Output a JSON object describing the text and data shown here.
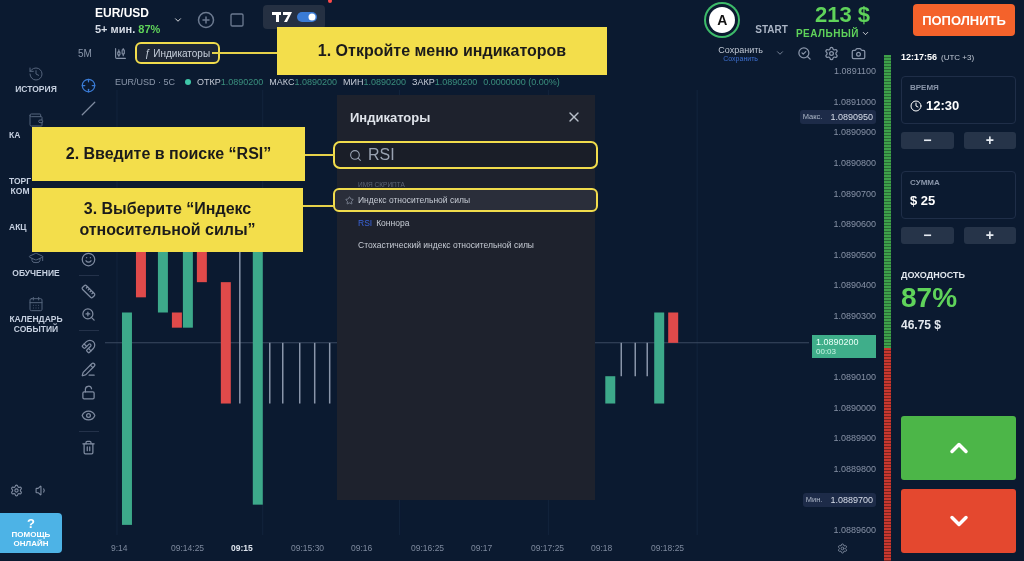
{
  "asset": {
    "pair": "EUR/USD",
    "duration": "5+ мин.",
    "payout": "87%"
  },
  "account": {
    "avatar": "A",
    "level": "START",
    "balance": "213 $",
    "type": "РЕАЛЬНЫЙ"
  },
  "deposit_button": "ПОПОЛНИТЬ",
  "chart_toggle": {
    "on": true
  },
  "sidebar": {
    "items": [
      {
        "kind": "history",
        "label": "ИСТОРИЯ",
        "clipped": false
      },
      {
        "kind": "wallet",
        "label": "КА",
        "clipped": true
      },
      {
        "kind": "blank",
        "label": "ТОРГ\nКОМ",
        "clipped": true
      },
      {
        "kind": "blank",
        "label": "АКЦ",
        "clipped": true
      },
      {
        "kind": "education",
        "label": "ОБУЧЕНИЕ",
        "clipped": false
      },
      {
        "kind": "calendar",
        "label": "КАЛЕНДАРЬ\nСОБЫТИЙ",
        "clipped": false
      }
    ],
    "help": {
      "mark": "?",
      "label": "ПОМОЩЬ\nОНЛАЙН"
    }
  },
  "chart_toolbar": {
    "timeframe": "5M",
    "indicators_button": {
      "symbol": "ƒ",
      "label": "Индикаторы",
      "highlighted": true
    },
    "save": "Сохранить",
    "save_hint": "Сохранить"
  },
  "legend": {
    "symbol": "EUR/USD · 5C",
    "values": [
      {
        "label": "ОТКР",
        "value": "1.0890200"
      },
      {
        "label": "МАКС",
        "value": "1.0890200"
      },
      {
        "label": "МИН",
        "value": "1.0890200"
      },
      {
        "label": "ЗАКР",
        "value": "1.0890200"
      }
    ],
    "change": "0.0000000 (0.00%)"
  },
  "price_axis": [
    {
      "kind": "plain",
      "value": "1.0891100"
    },
    {
      "kind": "plain",
      "value": "1.0891000"
    },
    {
      "kind": "marker",
      "tag": "Макс.",
      "value": "1.0890950"
    },
    {
      "kind": "plain",
      "value": "1.0890900"
    },
    {
      "kind": "plain",
      "value": "1.0890800"
    },
    {
      "kind": "plain",
      "value": "1.0890700"
    },
    {
      "kind": "plain",
      "value": "1.0890600"
    },
    {
      "kind": "plain",
      "value": "1.0890500"
    },
    {
      "kind": "plain",
      "value": "1.0890400"
    },
    {
      "kind": "plain",
      "value": "1.0890300"
    },
    {
      "kind": "current",
      "value": "1.0890200",
      "time": "00:03"
    },
    {
      "kind": "plain",
      "value": "1.0890100"
    },
    {
      "kind": "plain",
      "value": "1.0890000"
    },
    {
      "kind": "plain",
      "value": "1.0889900"
    },
    {
      "kind": "plain",
      "value": "1.0889800"
    },
    {
      "kind": "tagged",
      "tag": "Мин.",
      "value": "1.0889700"
    },
    {
      "kind": "plain",
      "value": "1.0889600"
    }
  ],
  "time_axis": [
    {
      "label": "9:14",
      "bold": false
    },
    {
      "label": "09:14:25",
      "bold": false
    },
    {
      "label": "09:15",
      "bold": true
    },
    {
      "label": "09:15:30",
      "bold": false
    },
    {
      "label": "09:16",
      "bold": false
    },
    {
      "label": "09:16:25",
      "bold": false
    },
    {
      "label": "09:17",
      "bold": false
    },
    {
      "label": "09:17:25",
      "bold": false
    },
    {
      "label": "09:18",
      "bold": false
    },
    {
      "label": "09:18:25",
      "bold": false
    }
  ],
  "sentiment": {
    "level": 0.58
  },
  "trade_panel": {
    "clock": "12:17:56",
    "timezone": "(UTC +3)",
    "time": {
      "label": "ВРЕМЯ",
      "value": "12:30"
    },
    "amount": {
      "label": "СУММА",
      "value": "$ 25"
    },
    "minus": "−",
    "plus": "+",
    "payout_label": "ДОХОДНОСТЬ",
    "payout": "87%",
    "profit": "46.75 $"
  },
  "indicators_dialog": {
    "title": "Индикаторы",
    "search": {
      "value": "RSI",
      "highlighted": true
    },
    "section": "ИМЯ СКРИПТА",
    "results": [
      {
        "parts": [
          {
            "text": "Индекс относительной силы",
            "match": false
          }
        ],
        "favorite": true,
        "selected": true
      },
      {
        "parts": [
          {
            "text": "RSI",
            "match": true
          },
          {
            "text": "Коннора",
            "match": false
          }
        ],
        "favorite": false,
        "selected": false
      },
      {
        "parts": [
          {
            "text": "Стохастический индекс относительной силы",
            "match": false
          }
        ],
        "favorite": false,
        "selected": false
      }
    ]
  },
  "callouts": [
    {
      "text": "1. Откройте меню индикаторов"
    },
    {
      "text": "2. Введите в поиске “RSI”"
    },
    {
      "text": "3. Выберите “Индекс\nотносительной силы”"
    }
  ]
}
